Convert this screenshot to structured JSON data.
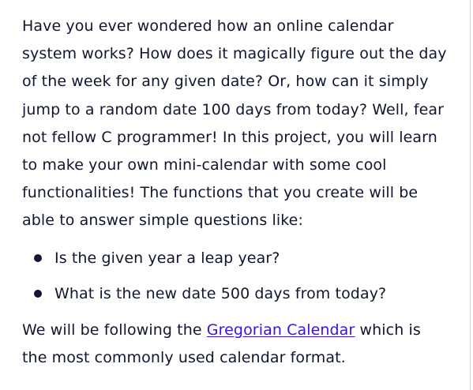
{
  "intro": {
    "text": "Have you ever wondered how an online calendar system works? How does it magically figure out the day of the week for any given date? Or, how can it simply jump to a random date 100 days from today? Well, fear not fellow C programmer! In this project, you will learn to make your own mini-calendar with some cool functionalities! The functions that you create will be able to answer simple questions like:"
  },
  "questions": [
    "Is the given year a leap year?",
    "What is the new date 500 days from today?"
  ],
  "outro": {
    "before_link": "We will be following the ",
    "link_text": "Gregorian Calendar",
    "after_link": " which is the most commonly used calendar format."
  },
  "colors": {
    "text": "#10162f",
    "link": "#3a10e5",
    "background": "#ffffff"
  }
}
